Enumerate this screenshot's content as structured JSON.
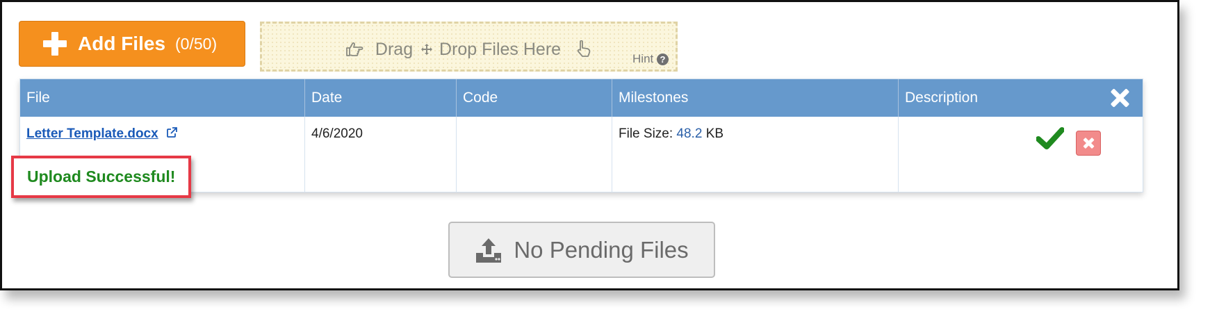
{
  "toolbar": {
    "add_files_label": "Add Files",
    "add_files_count": "(0/50)",
    "dropzone_drag": "Drag",
    "dropzone_drop": "Drop Files Here",
    "hint_label": "Hint",
    "hint_icon": "?"
  },
  "table": {
    "columns": [
      "File",
      "Date",
      "Code",
      "Milestones",
      "Description"
    ],
    "rows": [
      {
        "file_name": "Letter Template.docx",
        "date": "4/6/2020",
        "code": "",
        "file_size_label": "File Size:",
        "file_size_value": "48.2",
        "file_size_unit": "KB",
        "status": "Upload Successful!"
      }
    ]
  },
  "pending_button": {
    "label": "No Pending Files"
  },
  "colors": {
    "add_button": "#f5901e",
    "header": "#6699cc",
    "success_text": "#1f8a1f",
    "highlight_border": "#e63946",
    "link": "#1a5ab8"
  },
  "icons": {
    "add": "plus-icon",
    "drag_left": "pointing-hand-right-icon",
    "move": "move-arrows-icon",
    "drag_right": "pointing-hand-left-icon",
    "hint": "question-circle-icon",
    "close": "close-icon",
    "external": "external-link-icon",
    "success": "checkmark-icon",
    "delete": "delete-icon",
    "pending": "upload-icon"
  }
}
